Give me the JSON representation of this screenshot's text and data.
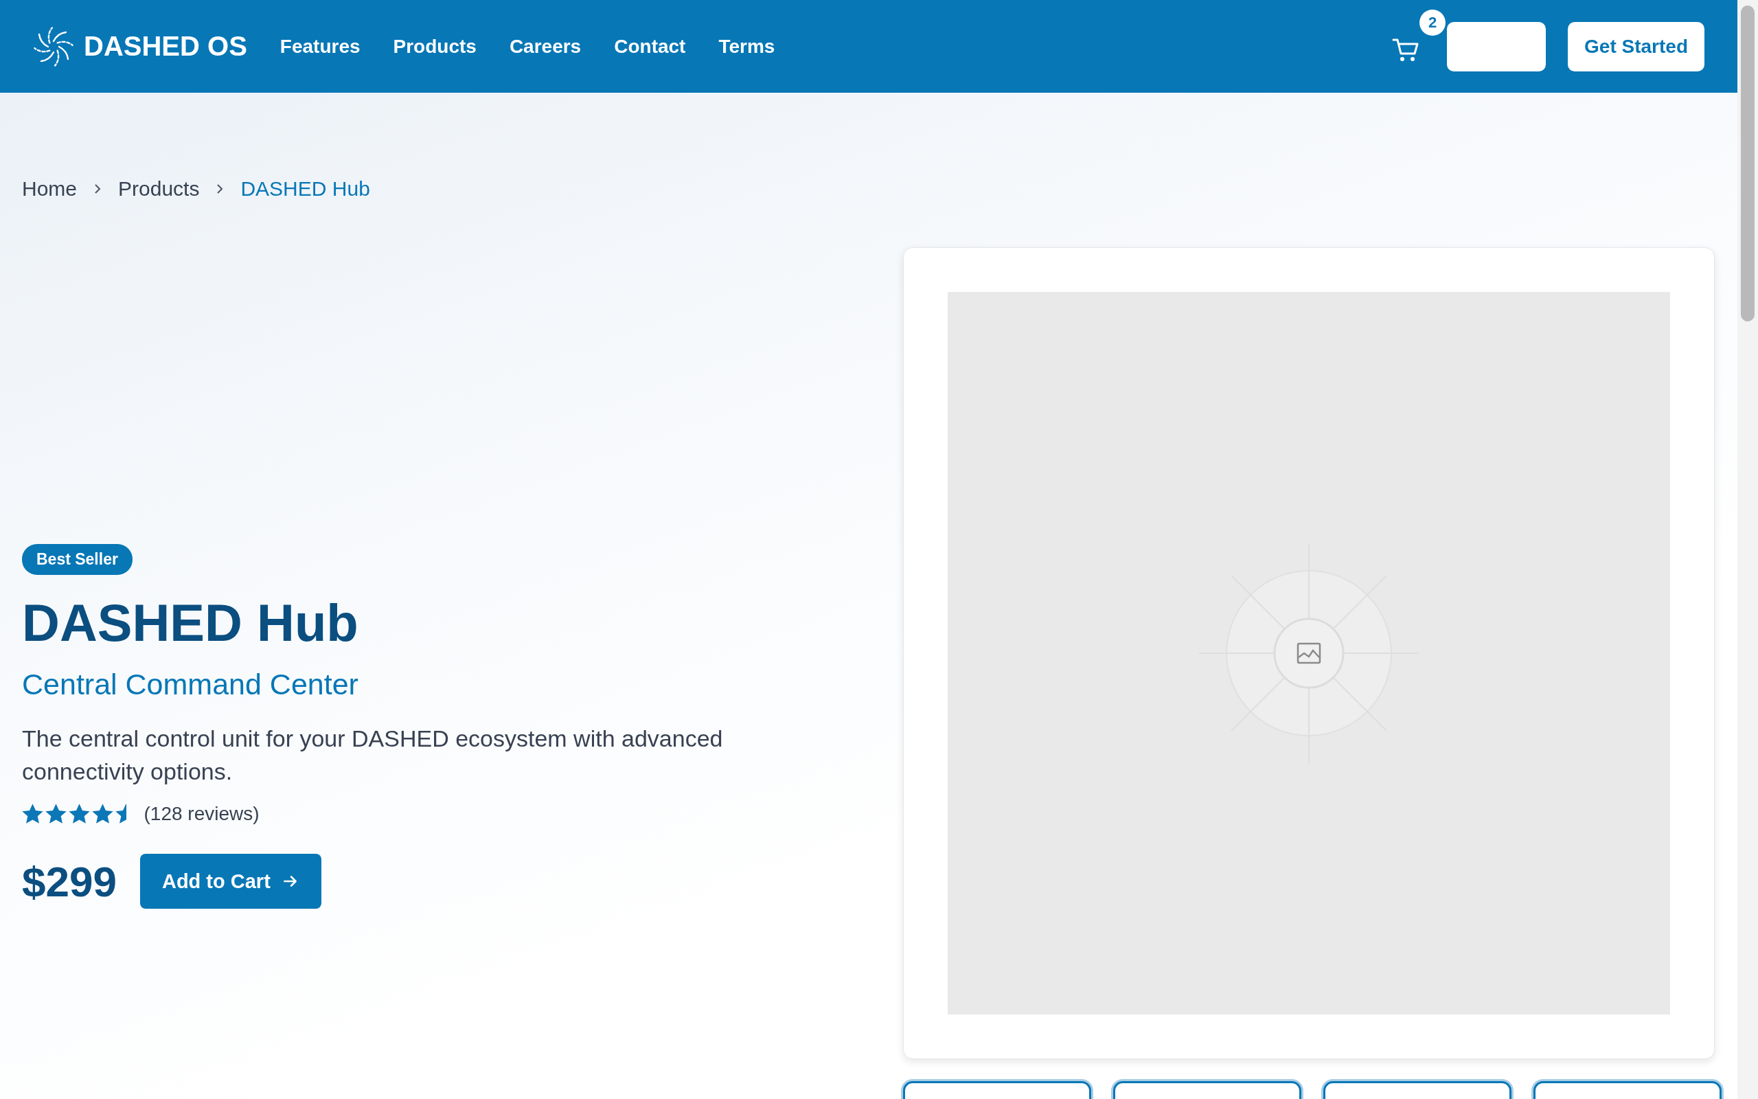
{
  "header": {
    "logo": "DASHED OS",
    "nav": [
      "Features",
      "Products",
      "Careers",
      "Contact",
      "Terms"
    ],
    "cart_count": "2",
    "cta": "Get Started"
  },
  "breadcrumb": [
    {
      "label": "Home",
      "current": false
    },
    {
      "label": "Products",
      "current": false
    },
    {
      "label": "DASHED Hub",
      "current": true
    }
  ],
  "product": {
    "badge": "Best Seller",
    "title": "DASHED Hub",
    "subtitle": "Central Command Center",
    "description": "The central control unit for your DASHED ecosystem with advanced connectivity options.",
    "rating": {
      "stars": 4.5,
      "reviews": "(128 reviews)"
    },
    "price": "$299",
    "add_to_cart": "Add to Cart"
  },
  "gallery": {
    "main": {
      "kind": "placeholder"
    },
    "thumbnails": [
      {
        "kind": "placeholder"
      },
      {
        "kind": "placeholder"
      },
      {
        "kind": "placeholder"
      },
      {
        "kind": "placeholder"
      }
    ]
  }
}
